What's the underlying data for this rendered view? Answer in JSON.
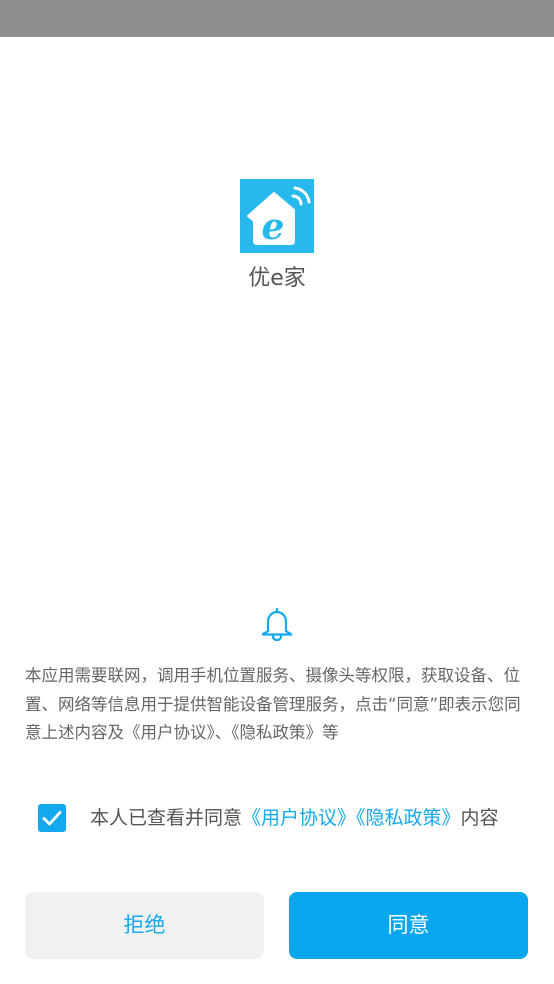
{
  "app": {
    "name": "优e家",
    "logo_letter": "e",
    "logo_bg_color": "#27b8ee"
  },
  "notice": {
    "icon": "bell-icon",
    "text": "本应用需要联网，调用手机位置服务、摄像头等权限，获取设备、位置、网络等信息用于提供智能设备管理服务，点击“同意”即表示您同意上述内容及《用户协议》、《隐私政策》等"
  },
  "agreement": {
    "checked": true,
    "prefix": "本人已查看并同意",
    "user_agreement_link": "《用户协议》",
    "privacy_policy_link": "《隐私政策》",
    "suffix": "内容"
  },
  "buttons": {
    "reject_label": "拒绝",
    "agree_label": "同意"
  },
  "colors": {
    "accent": "#14a9ef",
    "status_bar": "#8f8f8f",
    "reject_bg": "#f1f1f1"
  }
}
